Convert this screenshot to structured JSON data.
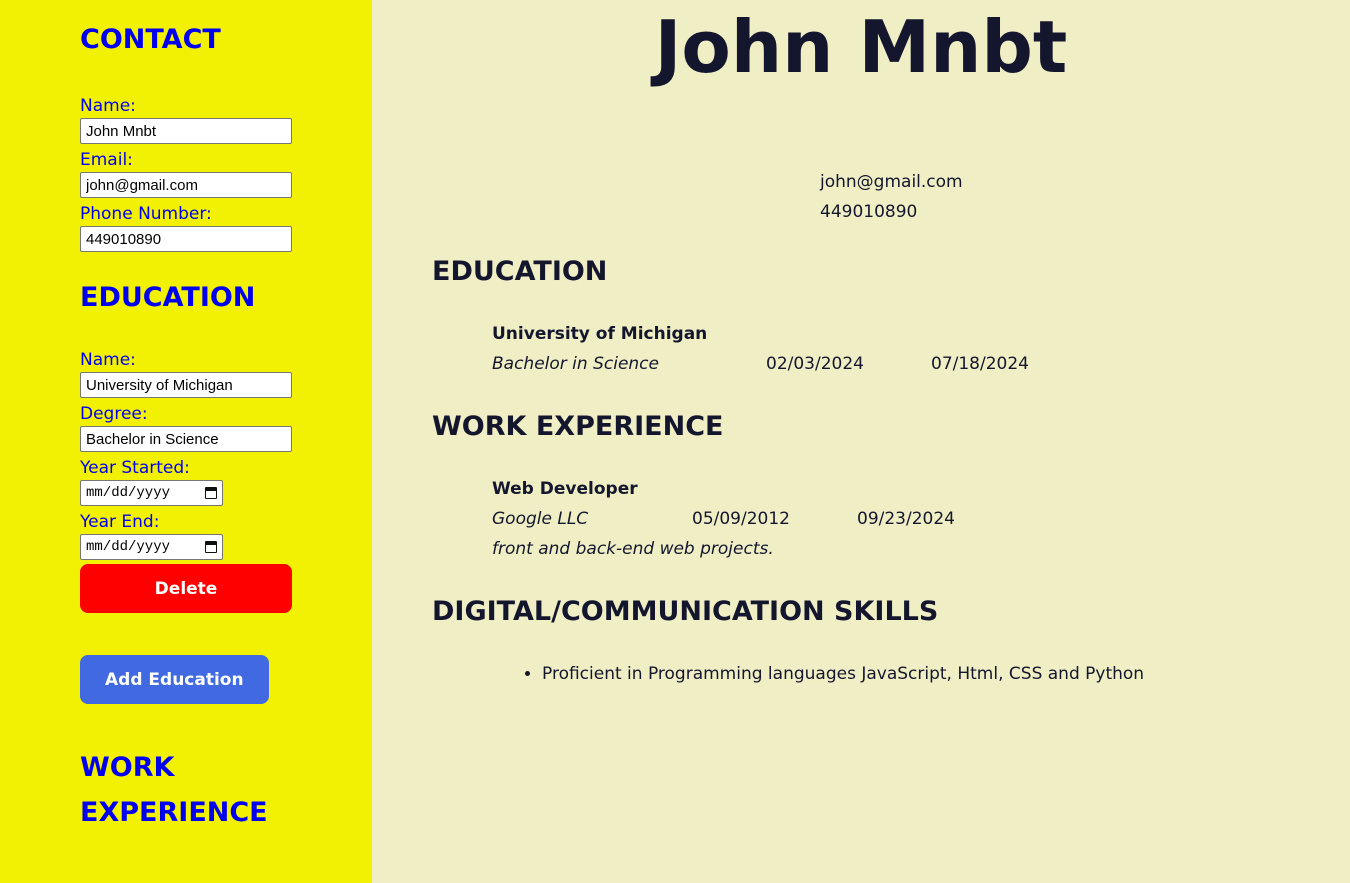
{
  "sidebar": {
    "contact_title": "CONTACT",
    "contact": {
      "name_label": "Name:",
      "name_value": "John Mnbt",
      "email_label": "Email:",
      "email_value": "john@gmail.com",
      "phone_label": "Phone Number:",
      "phone_value": "449010890"
    },
    "education_title": "EDUCATION",
    "education": {
      "name_label": "Name:",
      "name_value": "University of Michigan",
      "degree_label": "Degree:",
      "degree_value": "Bachelor in Science",
      "started_label": "Year Started:",
      "started_placeholder": "mm/dd/yyyy",
      "end_label": "Year End:",
      "end_placeholder": "mm/dd/yyyy",
      "delete_label": "Delete",
      "add_label": "Add Education"
    },
    "work_title_line1": "WORK",
    "work_title_line2": "EXPERIENCE"
  },
  "resume": {
    "name": "John Mnbt",
    "email": "john@gmail.com",
    "phone": "449010890",
    "education_heading": "EDUCATION",
    "education_entry": {
      "school": "University of Michigan",
      "degree": "Bachelor in Science",
      "start": "02/03/2024",
      "end": "07/18/2024"
    },
    "work_heading": "WORK EXPERIENCE",
    "work_entry": {
      "title": "Web Developer",
      "company": "Google LLC",
      "start": "05/09/2012",
      "end": "09/23/2024",
      "description": "front and back-end web projects."
    },
    "skills_heading": "DIGITAL/COMMUNICATION SKILLS",
    "skills": [
      "Proficient in Programming languages JavaScript, Html, CSS and Python"
    ]
  },
  "colors": {
    "sidebar_bg": "#f2f104",
    "main_bg": "#efeec4",
    "sidebar_text": "#0000ee",
    "delete_button": "#ff0000",
    "add_button": "#4169e1"
  }
}
